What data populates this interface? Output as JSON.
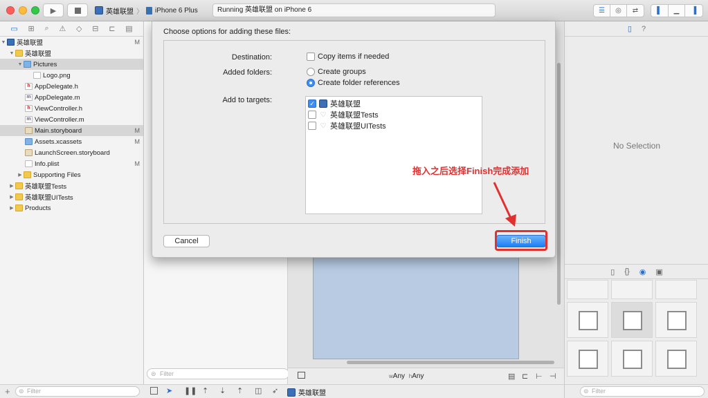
{
  "toolbar": {
    "scheme_name": "英雄联盟",
    "device": "iPhone 6 Plus",
    "activity_status": "Running 英雄联盟 on iPhone 6"
  },
  "navigator": {
    "rows": [
      {
        "label": "英雄联盟",
        "badge": "M"
      },
      {
        "label": "英雄联盟",
        "badge": ""
      },
      {
        "label": "Pictures",
        "badge": ""
      },
      {
        "label": "Logo.png",
        "badge": ""
      },
      {
        "label": "AppDelegate.h",
        "badge": ""
      },
      {
        "label": "AppDelegate.m",
        "badge": ""
      },
      {
        "label": "ViewController.h",
        "badge": ""
      },
      {
        "label": "ViewController.m",
        "badge": ""
      },
      {
        "label": "Main.storyboard",
        "badge": "M"
      },
      {
        "label": "Assets.xcassets",
        "badge": "M"
      },
      {
        "label": "LaunchScreen.storyboard",
        "badge": ""
      },
      {
        "label": "Info.plist",
        "badge": "M"
      },
      {
        "label": "Supporting Files",
        "badge": ""
      },
      {
        "label": "英雄联盟Tests",
        "badge": ""
      },
      {
        "label": "英雄联盟UITests",
        "badge": ""
      },
      {
        "label": "Products",
        "badge": ""
      }
    ],
    "filter_placeholder": "Filter"
  },
  "middle": {
    "filter_placeholder": "Filter"
  },
  "canvas": {
    "size_w_prefix": "w",
    "size_w": "Any",
    "size_h_prefix": "h",
    "size_h": "Any"
  },
  "inspector": {
    "empty_text": "No Selection",
    "filter_placeholder": "Filter"
  },
  "bottom_bar": {
    "target_name": "英雄联盟"
  },
  "dialog": {
    "title": "Choose options for adding these files:",
    "destination_label": "Destination:",
    "copy_items_label": "Copy items if needed",
    "added_folders_label": "Added folders:",
    "create_groups_label": "Create groups",
    "create_folder_refs_label": "Create folder references",
    "add_to_targets_label": "Add to targets:",
    "targets": [
      {
        "name": "英雄联盟",
        "checked": true
      },
      {
        "name": "英雄联盟Tests",
        "checked": false
      },
      {
        "name": "英雄联盟UITests",
        "checked": false
      }
    ],
    "cancel_label": "Cancel",
    "finish_label": "Finish"
  },
  "annotation": {
    "text": "拖入之后选择Finish完成添加",
    "color": "#e03030"
  },
  "colors": {
    "accent": "#1d7ef4",
    "selection_row": "#d6d6d6"
  }
}
